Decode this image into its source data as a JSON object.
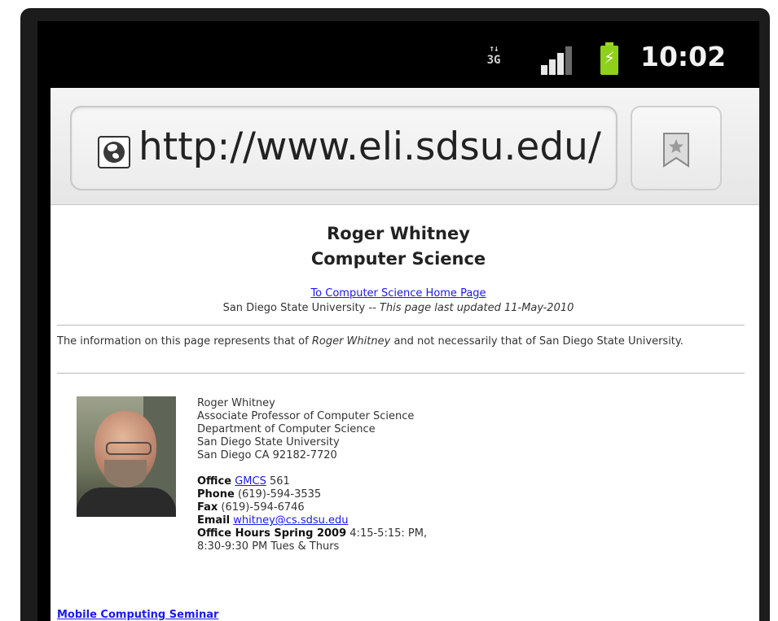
{
  "status_bar": {
    "network": {
      "arrows": "↑↓",
      "label": "3G"
    },
    "time": "10:02",
    "icons": [
      "network-3g-icon",
      "signal-strength-icon",
      "battery-charging-icon"
    ]
  },
  "browser": {
    "url": "http://www.eli.sdsu.edu/",
    "icons": [
      "globe-icon",
      "bookmark-icon"
    ]
  },
  "page": {
    "title": "Roger Whitney",
    "subtitle": "Computer Science",
    "home_link": "To Computer Science Home Page",
    "university": "San Diego State University --",
    "updated": "This page last updated 11-May-2010",
    "disclaimer": {
      "prefix": "The information on this page represents that of",
      "name": "Roger Whitney",
      "suffix": "and not necessarily that of San Diego State University."
    },
    "contact": {
      "name": "Roger Whitney",
      "title": "Associate Professor of Computer Science",
      "department": "Department of Computer Science",
      "university": "San Diego State University",
      "address": "San Diego CA 92182-7720",
      "office_label": "Office",
      "office_building": "GMCS",
      "office_room": "561",
      "phone_label": "Phone",
      "phone": "(619)-594-3535",
      "fax_label": "Fax",
      "fax": "(619)-594-6746",
      "email_label": "Email",
      "email": "whitney@cs.sdsu.edu",
      "hours_label": "Office Hours Spring 2009",
      "hours_line1": "4:15-5:15: PM,",
      "hours_line2": "8:30-9:30 PM Tues & Thurs"
    },
    "seminar_link": "Mobile Computing Seminar"
  }
}
